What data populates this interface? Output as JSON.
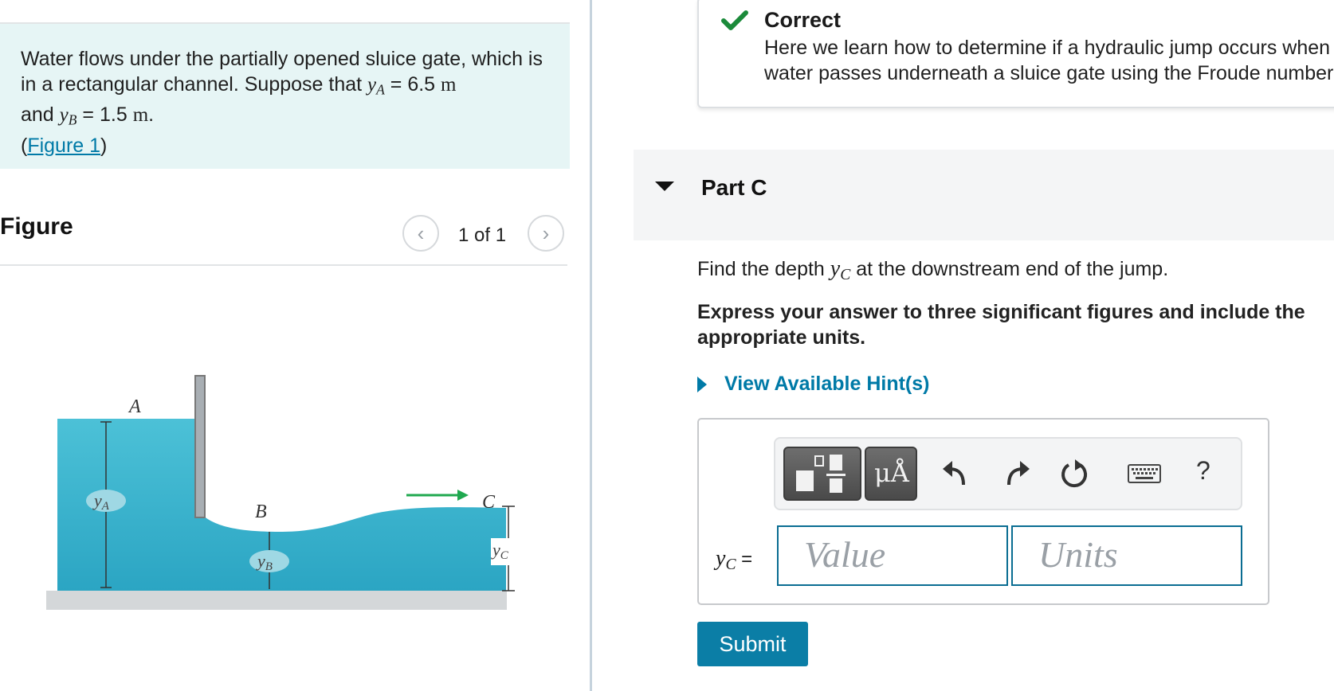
{
  "intro": {
    "text_1": "Water flows under the partially opened sluice gate, which is in a rectangular channel. Suppose that ",
    "ya_var": "y",
    "ya_sub": "A",
    "ya_value": " = 6.5 ",
    "unit_m": "m",
    "text_2": "and ",
    "yb_var": "y",
    "yb_sub": "B",
    "yb_value": " = 1.5 ",
    "text_end": ".",
    "figure_link_open": "(",
    "figure_link": "Figure 1",
    "figure_link_close": ")"
  },
  "figure": {
    "title": "Figure",
    "pager": "1 of 1",
    "labels": {
      "A": "A",
      "B": "B",
      "C": "C",
      "yA": "y",
      "yA_sub": "A",
      "yB": "y",
      "yB_sub": "B",
      "yC": "y",
      "yC_sub": "C"
    },
    "colors": {
      "water": "#3fb7cf",
      "arrow": "#1fa84f",
      "gate": "#a8aeb3"
    }
  },
  "feedback": {
    "status": "Correct",
    "line_1": "Here we learn how to determine if a hydraulic jump occurs when",
    "line_2": "water passes underneath a sluice gate using the Froude number"
  },
  "part": {
    "title": "Part C",
    "question_pre": "Find the depth ",
    "var": "y",
    "var_sub": "C",
    "question_post": " at the downstream end of the jump.",
    "instructions": "Express your answer to three significant figures and include the appropriate units.",
    "hint_label": "View Available Hint(s)"
  },
  "answer": {
    "toolbar": {
      "templates_icon": "templates-icon",
      "units_label": "μÅ",
      "undo_icon": "undo-icon",
      "redo_icon": "redo-icon",
      "reset_icon": "reset-icon",
      "keyboard_icon": "keyboard-icon",
      "help_label": "?"
    },
    "var": "y",
    "var_sub": "C",
    "equals": " =",
    "value_placeholder": "Value",
    "units_placeholder": "Units",
    "submit_label": "Submit"
  }
}
